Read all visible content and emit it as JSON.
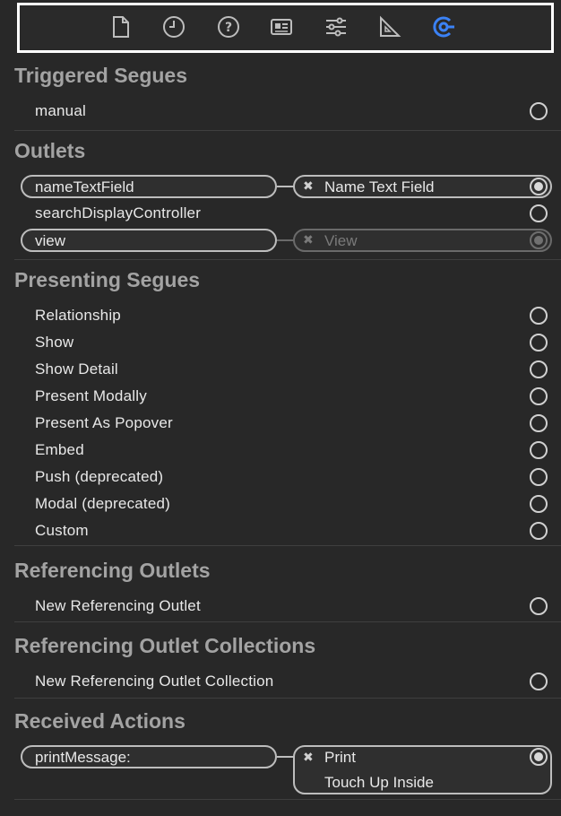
{
  "toolbar": {
    "icons": [
      "file-inspector-icon",
      "history-inspector-icon",
      "quick-help-icon",
      "identity-inspector-icon",
      "attributes-inspector-icon",
      "size-inspector-icon",
      "connections-inspector-icon"
    ],
    "selected": "connections-inspector-icon",
    "accent": "#3b82f6"
  },
  "sections": {
    "triggered_segues": {
      "title": "Triggered Segues",
      "rows": [
        "manual"
      ]
    },
    "outlets": {
      "title": "Outlets",
      "rows": [
        "nameTextField",
        "searchDisplayController",
        "view"
      ],
      "connections": [
        "Name Text Field",
        "View"
      ]
    },
    "presenting_segues": {
      "title": "Presenting Segues",
      "rows": [
        "Relationship",
        "Show",
        "Show Detail",
        "Present Modally",
        "Present As Popover",
        "Embed",
        "Push (deprecated)",
        "Modal (deprecated)",
        "Custom"
      ]
    },
    "referencing_outlets": {
      "title": "Referencing Outlets",
      "rows": [
        "New Referencing Outlet"
      ]
    },
    "referencing_outlet_collections": {
      "title": "Referencing Outlet Collections",
      "rows": [
        "New Referencing Outlet Collection"
      ]
    },
    "received_actions": {
      "title": "Received Actions",
      "rows": [
        "printMessage:"
      ],
      "connection": {
        "target": "Print",
        "event": "Touch Up Inside"
      }
    }
  }
}
